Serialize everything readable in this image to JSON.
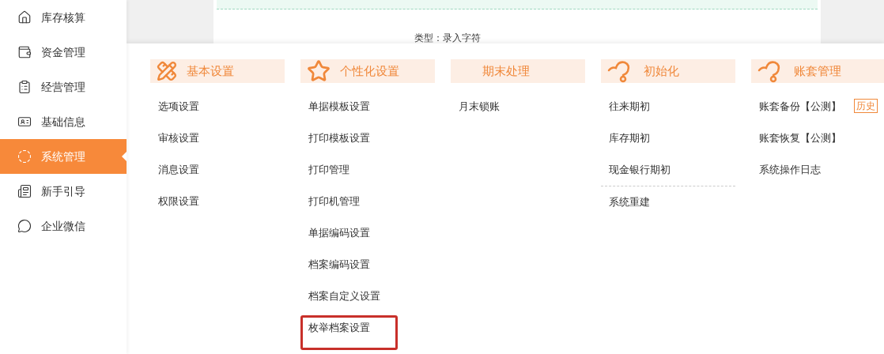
{
  "sidebar": {
    "items": [
      {
        "label": "库存核算",
        "selected": false
      },
      {
        "label": "资金管理",
        "selected": false
      },
      {
        "label": "经营管理",
        "selected": false
      },
      {
        "label": "基础信息",
        "selected": false
      },
      {
        "label": "系统管理",
        "selected": true
      },
      {
        "label": "新手引导",
        "selected": false
      },
      {
        "label": "企业微信",
        "selected": false
      }
    ]
  },
  "background": {
    "field_label": "类型：录入字符"
  },
  "menu": {
    "columns": [
      {
        "title": "基本设置",
        "items": [
          {
            "label": "选项设置"
          },
          {
            "label": "审核设置"
          },
          {
            "label": "消息设置"
          },
          {
            "label": "权限设置"
          }
        ]
      },
      {
        "title": "个性化设置",
        "items": [
          {
            "label": "单据模板设置"
          },
          {
            "label": "打印模板设置"
          },
          {
            "label": "打印管理"
          },
          {
            "label": "打印机管理"
          },
          {
            "label": "单据编码设置"
          },
          {
            "label": "档案编码设置"
          },
          {
            "label": "档案自定义设置"
          },
          {
            "label": "枚举档案设置",
            "highlighted": true
          }
        ]
      },
      {
        "title": "期末处理",
        "items": [
          {
            "label": "月末锁账"
          }
        ]
      },
      {
        "title": "初始化",
        "items": [
          {
            "label": "往来期初"
          },
          {
            "label": "库存期初"
          },
          {
            "label": "现金银行期初"
          },
          {
            "label": "系统重建",
            "divider_before": true
          }
        ]
      },
      {
        "title": "账套管理",
        "items": [
          {
            "label": "账套备份【公测】",
            "badge": "历史"
          },
          {
            "label": "账套恢复【公测】"
          },
          {
            "label": "系统操作日志"
          }
        ]
      }
    ]
  }
}
